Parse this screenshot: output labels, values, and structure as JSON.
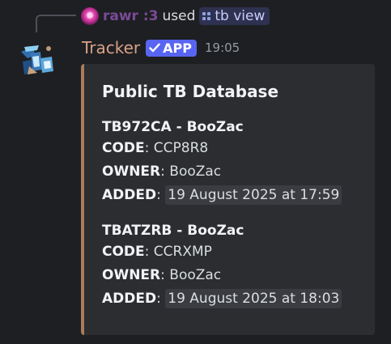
{
  "command": {
    "user": "rawr :3",
    "used_text": "used",
    "command_name": "tb view"
  },
  "message": {
    "author": "Tracker",
    "app_badge": "APP",
    "time": "19:05"
  },
  "embed": {
    "title": "Public TB Database",
    "accent_color": "#a97c5b",
    "entries": [
      {
        "title": "TB972CA - BooZac",
        "code_label": "CODE",
        "code": "CCP8R8",
        "owner_label": "OWNER",
        "owner": "BooZac",
        "added_label": "ADDED",
        "added": "19 August 2025 at 17:59"
      },
      {
        "title": "TBATZRB - BooZac",
        "code_label": "CODE",
        "code": "CCRXMP",
        "owner_label": "OWNER",
        "owner": "BooZac",
        "added_label": "ADDED",
        "added": "19 August 2025 at 18:03"
      }
    ]
  }
}
